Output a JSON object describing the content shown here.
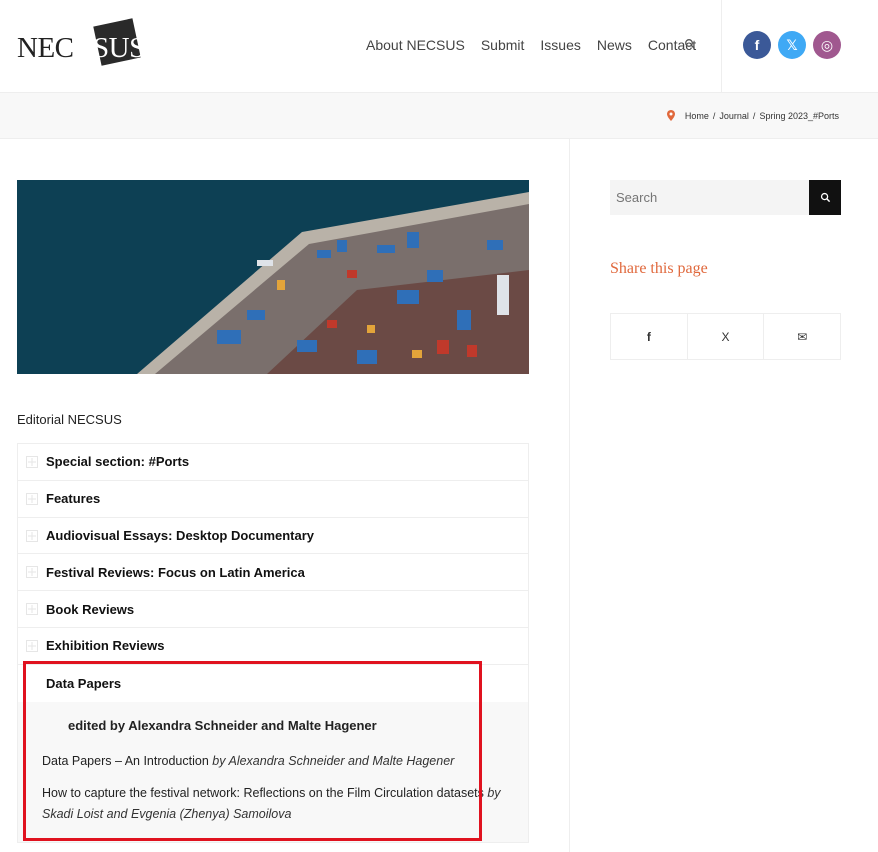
{
  "site": {
    "logo_text": "NEC",
    "logo_inverted": "SUS"
  },
  "nav": {
    "items": [
      "About NECSUS",
      "Submit",
      "Issues",
      "News",
      "Contact"
    ]
  },
  "social": {
    "facebook": "f",
    "twitter": "𝕏",
    "instagram": "◎"
  },
  "breadcrumb": {
    "items": [
      "Home",
      "Journal",
      "Spring 2023_#Ports"
    ],
    "separator": "/"
  },
  "main": {
    "editorial_link": "Editorial NECSUS",
    "sections": [
      "Special section: #Ports",
      "Features",
      "Audiovisual Essays: Desktop Documentary",
      "Festival Reviews: Focus on Latin America",
      "Book Reviews",
      "Exhibition Reviews"
    ],
    "open_section": {
      "title": "Data Papers",
      "edited_by": "edited by Alexandra Schneider and Malte Hagener",
      "articles": [
        {
          "title": "Data Papers – An Introduction",
          "author": "by Alexandra Schneider and Malte Hagener"
        },
        {
          "title": "How to capture the festival network: Reflections on the Film Circulation datasets",
          "author": "by  Skadi Loist and Evgenia (Zhenya) Samoilova"
        }
      ]
    }
  },
  "sidebar": {
    "search_placeholder": "Search",
    "share_title": "Share this page",
    "share_icons": [
      "f",
      "X",
      "✉"
    ]
  },
  "colors": {
    "accent": "#e0683c",
    "highlight": "#e0121f",
    "facebook": "#3b5998",
    "twitter": "#3fa9f5",
    "instagram": "#a0588f"
  }
}
